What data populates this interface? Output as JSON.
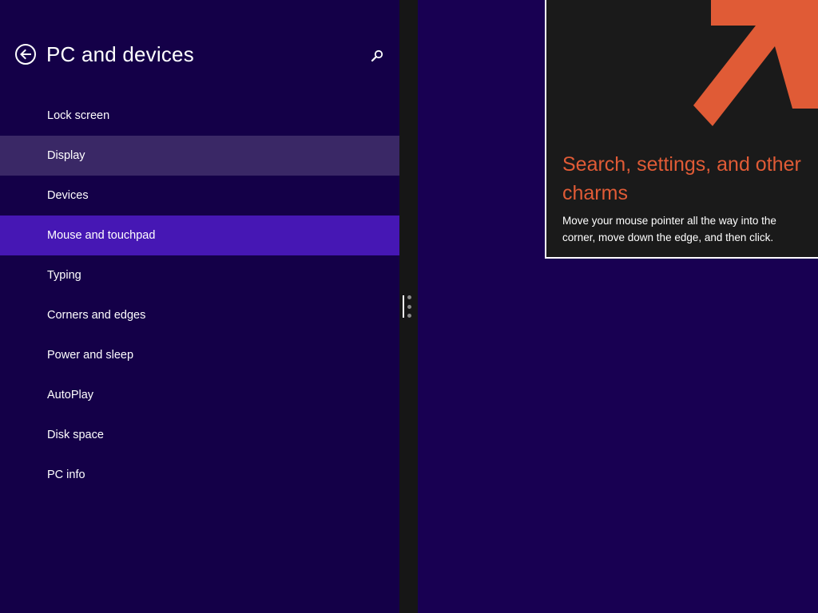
{
  "header": {
    "title": "PC and devices",
    "back_icon": "back-arrow-icon",
    "search_icon": "search-icon"
  },
  "nav": {
    "items": [
      {
        "label": "Lock screen",
        "state": "normal"
      },
      {
        "label": "Display",
        "state": "hover"
      },
      {
        "label": "Devices",
        "state": "normal"
      },
      {
        "label": "Mouse and touchpad",
        "state": "selected"
      },
      {
        "label": "Typing",
        "state": "normal"
      },
      {
        "label": "Corners and edges",
        "state": "normal"
      },
      {
        "label": "Power and sleep",
        "state": "normal"
      },
      {
        "label": "AutoPlay",
        "state": "normal"
      },
      {
        "label": "Disk space",
        "state": "normal"
      },
      {
        "label": "PC info",
        "state": "normal"
      }
    ]
  },
  "tip": {
    "heading": "Search, settings, and other charms",
    "body": "Move your mouse pointer all the way into the corner, move down the edge, and then click.",
    "arrow_icon": "diagonal-arrow-icon"
  },
  "colors": {
    "background": "#180052",
    "left_pane": "#140048",
    "hover": "#3a2866",
    "selected": "#4617b4",
    "accent": "#e05b36",
    "tip_background": "#1a1a1a"
  }
}
